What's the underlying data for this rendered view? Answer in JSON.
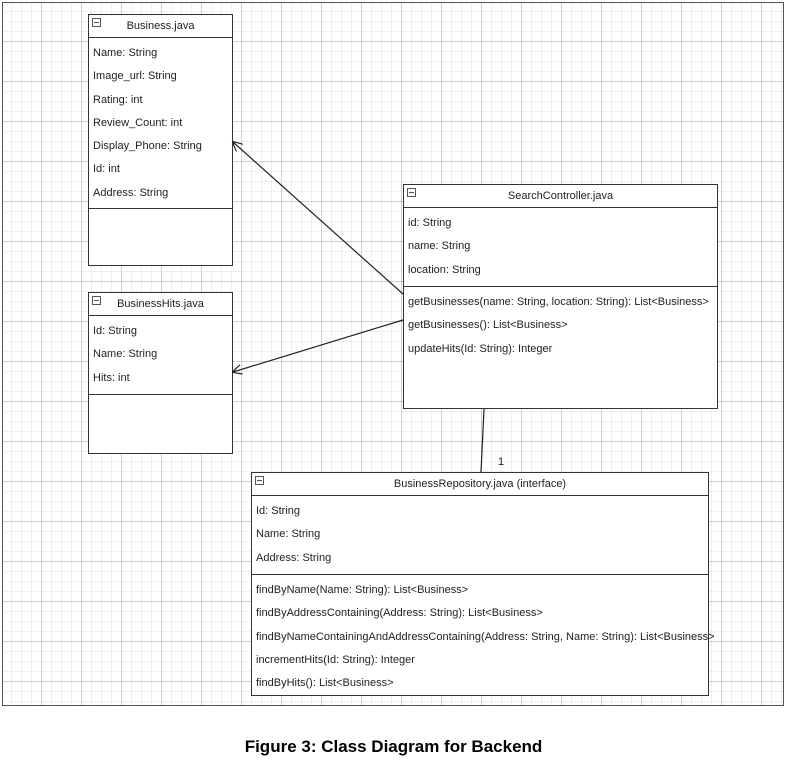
{
  "classes": [
    {
      "key": "business",
      "name": "Business.java",
      "attributes": [
        "Name: String",
        "Image_url: String",
        "Rating: int",
        "Review_Count: int",
        "Display_Phone: String",
        "Id: int",
        "Address: String"
      ],
      "methods": []
    },
    {
      "key": "business_hits",
      "name": "BusinessHits.java",
      "attributes": [
        "Id: String",
        "Name: String",
        "Hits: int"
      ],
      "methods": []
    },
    {
      "key": "search_controller",
      "name": "SearchController.java",
      "attributes": [
        "id: String",
        "name: String",
        "location: String"
      ],
      "methods": [
        "getBusinesses(name: String, location: String): List<Business>",
        "getBusinesses(): List<Business>",
        "updateHits(Id: String): Integer"
      ]
    },
    {
      "key": "business_repository",
      "name": "BusinessRepository.java (interface)",
      "attributes": [
        "Id: String",
        "Name: String",
        "Address: String"
      ],
      "methods": [
        "findByName(Name: String): List<Business>",
        "findByAddressContaining(Address: String): List<Business>",
        "findByNameContainingAndAddressContaining(Address: String, Name: String): List<Business>",
        "incrementHits(Id: String): Integer",
        "findByHits(): List<Business>"
      ]
    }
  ],
  "associations": [
    {
      "from": "search_controller",
      "to": "business",
      "type": "directed"
    },
    {
      "from": "search_controller",
      "to": "business_hits",
      "type": "directed"
    },
    {
      "from": "search_controller",
      "to": "business_repository",
      "type": "plain",
      "multiplicity": "1"
    }
  ],
  "caption": "Figure 3: Class Diagram for Backend"
}
